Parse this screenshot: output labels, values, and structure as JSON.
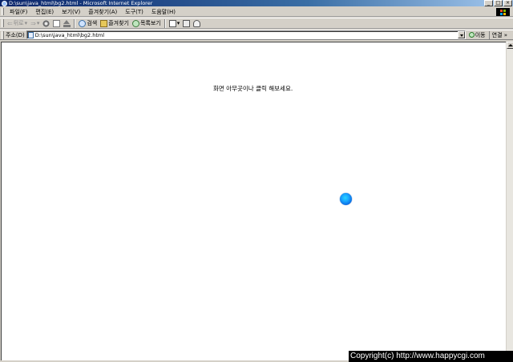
{
  "window": {
    "title": "D:\\sun\\java_html\\bg2.html - Microsoft Internet Explorer",
    "buttons": [
      "_",
      "□",
      "×"
    ]
  },
  "menu": {
    "items": [
      "파일(F)",
      "편집(E)",
      "보기(V)",
      "즐겨찾기(A)",
      "도구(T)",
      "도움말(H)"
    ]
  },
  "toolbar": {
    "back_label": "뒤로",
    "search_label": "검색",
    "favorites_label": "즐겨찾기",
    "history_label": "목록보기"
  },
  "address": {
    "label": "주소(D)",
    "value": "D:\\sun\\java_html\\bg2.html",
    "go_label": "이동",
    "links_label": "연결"
  },
  "page": {
    "message": "화면 아무곳이나 클릭 해보세요."
  },
  "banner": {
    "copyright": "Copyright(c) http://www.happycgi.com"
  },
  "colors": {
    "ball": "#1aa8ff",
    "titlebar": "#0a246a"
  }
}
